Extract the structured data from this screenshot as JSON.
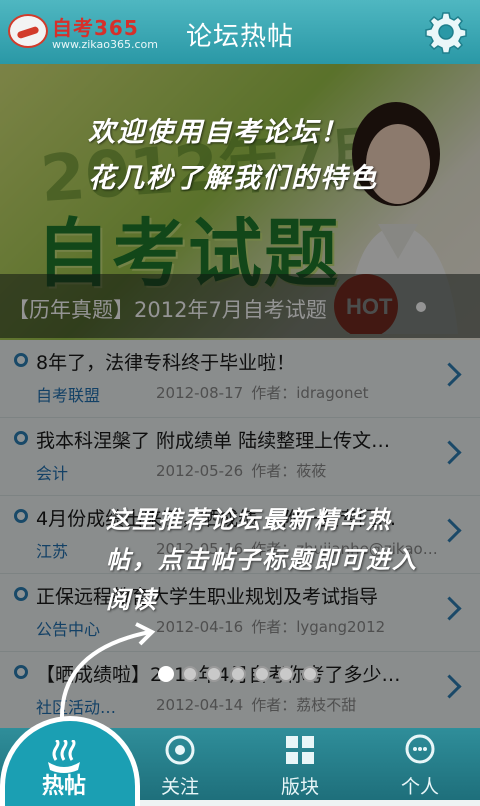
{
  "header": {
    "logo_text": "自考365",
    "logo_url": "www.zikao365.com",
    "title": "论坛热帖"
  },
  "banner": {
    "year_text": "2012年7月",
    "headline": "自考试题",
    "caption": "【历年真题】2012年7月自考试题"
  },
  "posts": [
    {
      "title": "8年了，法律专科终于毕业啦！",
      "category": "自考联盟",
      "date": "2012-08-17",
      "author_label": "作者：",
      "author": "idragonet"
    },
    {
      "title": "我本科涅槃了 附成绩单  陆续整理上传文…",
      "category": "会计",
      "date": "2012-05-26",
      "author_label": "作者：",
      "author": "莜莜"
    },
    {
      "title": "4月份成绩出来了，晒成绩 ，附一些专门…",
      "category": "江苏",
      "date": "2012-05-16",
      "author_label": "作者：",
      "author": "zhujianhe@zikao…"
    },
    {
      "title": "正保远程教育大学生职业规划及考试指导",
      "category": "公告中心",
      "date": "2012-04-16",
      "author_label": "作者：",
      "author": "lygang2012"
    },
    {
      "title": "【晒成绩啦】2012年4月自考你考了多少…",
      "category": "社区活动…",
      "date": "2012-04-14",
      "author_label": "作者：",
      "author": "荔枝不甜"
    }
  ],
  "overlay": {
    "tip1_line1": "欢迎使用自考论坛！",
    "tip1_line2": "花几秒了解我们的特色",
    "tip2": "这里推荐论坛最新精华热帖，点击帖子标题即可进入阅读",
    "pager_count": 7,
    "pager_active": 0
  },
  "tabs": [
    {
      "label": "热帖",
      "icon": "hot-posts-icon",
      "active": true
    },
    {
      "label": "关注",
      "icon": "follow-icon",
      "active": false
    },
    {
      "label": "版块",
      "icon": "sections-icon",
      "active": false
    },
    {
      "label": "个人",
      "icon": "profile-icon",
      "active": false
    }
  ],
  "colors": {
    "header": "#2a98a6",
    "accent": "#1b9fb3",
    "link": "#2270b0"
  }
}
